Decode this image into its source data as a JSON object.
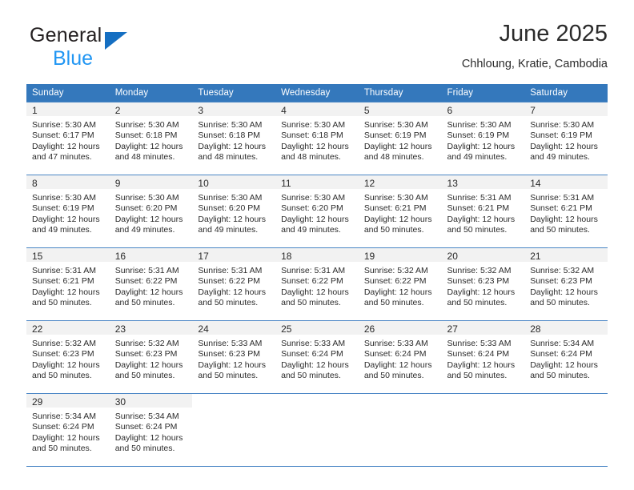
{
  "brand": {
    "name_top": "General",
    "name_bottom": "Blue",
    "triangle_color": "#156fc2",
    "blue_text_color": "#2196f3"
  },
  "header": {
    "title": "June 2025",
    "location": "Chhloung, Kratie, Cambodia"
  },
  "theme": {
    "header_background": "#3478bc",
    "header_text": "#ffffff",
    "grid_line": "#4a86c5",
    "daynum_strip": "#f2f2f2",
    "body_text": "#2b2b2b"
  },
  "weekday_headers": [
    "Sunday",
    "Monday",
    "Tuesday",
    "Wednesday",
    "Thursday",
    "Friday",
    "Saturday"
  ],
  "labels": {
    "sunrise_prefix": "Sunrise:",
    "sunset_prefix": "Sunset:",
    "daylight_prefix": "Daylight:"
  },
  "weeks": [
    [
      {
        "day": "1",
        "sunrise": "Sunrise: 5:30 AM",
        "sunset": "Sunset: 6:17 PM",
        "daylight_line1": "Daylight: 12 hours",
        "daylight_line2": "and 47 minutes."
      },
      {
        "day": "2",
        "sunrise": "Sunrise: 5:30 AM",
        "sunset": "Sunset: 6:18 PM",
        "daylight_line1": "Daylight: 12 hours",
        "daylight_line2": "and 48 minutes."
      },
      {
        "day": "3",
        "sunrise": "Sunrise: 5:30 AM",
        "sunset": "Sunset: 6:18 PM",
        "daylight_line1": "Daylight: 12 hours",
        "daylight_line2": "and 48 minutes."
      },
      {
        "day": "4",
        "sunrise": "Sunrise: 5:30 AM",
        "sunset": "Sunset: 6:18 PM",
        "daylight_line1": "Daylight: 12 hours",
        "daylight_line2": "and 48 minutes."
      },
      {
        "day": "5",
        "sunrise": "Sunrise: 5:30 AM",
        "sunset": "Sunset: 6:19 PM",
        "daylight_line1": "Daylight: 12 hours",
        "daylight_line2": "and 48 minutes."
      },
      {
        "day": "6",
        "sunrise": "Sunrise: 5:30 AM",
        "sunset": "Sunset: 6:19 PM",
        "daylight_line1": "Daylight: 12 hours",
        "daylight_line2": "and 49 minutes."
      },
      {
        "day": "7",
        "sunrise": "Sunrise: 5:30 AM",
        "sunset": "Sunset: 6:19 PM",
        "daylight_line1": "Daylight: 12 hours",
        "daylight_line2": "and 49 minutes."
      }
    ],
    [
      {
        "day": "8",
        "sunrise": "Sunrise: 5:30 AM",
        "sunset": "Sunset: 6:19 PM",
        "daylight_line1": "Daylight: 12 hours",
        "daylight_line2": "and 49 minutes."
      },
      {
        "day": "9",
        "sunrise": "Sunrise: 5:30 AM",
        "sunset": "Sunset: 6:20 PM",
        "daylight_line1": "Daylight: 12 hours",
        "daylight_line2": "and 49 minutes."
      },
      {
        "day": "10",
        "sunrise": "Sunrise: 5:30 AM",
        "sunset": "Sunset: 6:20 PM",
        "daylight_line1": "Daylight: 12 hours",
        "daylight_line2": "and 49 minutes."
      },
      {
        "day": "11",
        "sunrise": "Sunrise: 5:30 AM",
        "sunset": "Sunset: 6:20 PM",
        "daylight_line1": "Daylight: 12 hours",
        "daylight_line2": "and 49 minutes."
      },
      {
        "day": "12",
        "sunrise": "Sunrise: 5:30 AM",
        "sunset": "Sunset: 6:21 PM",
        "daylight_line1": "Daylight: 12 hours",
        "daylight_line2": "and 50 minutes."
      },
      {
        "day": "13",
        "sunrise": "Sunrise: 5:31 AM",
        "sunset": "Sunset: 6:21 PM",
        "daylight_line1": "Daylight: 12 hours",
        "daylight_line2": "and 50 minutes."
      },
      {
        "day": "14",
        "sunrise": "Sunrise: 5:31 AM",
        "sunset": "Sunset: 6:21 PM",
        "daylight_line1": "Daylight: 12 hours",
        "daylight_line2": "and 50 minutes."
      }
    ],
    [
      {
        "day": "15",
        "sunrise": "Sunrise: 5:31 AM",
        "sunset": "Sunset: 6:21 PM",
        "daylight_line1": "Daylight: 12 hours",
        "daylight_line2": "and 50 minutes."
      },
      {
        "day": "16",
        "sunrise": "Sunrise: 5:31 AM",
        "sunset": "Sunset: 6:22 PM",
        "daylight_line1": "Daylight: 12 hours",
        "daylight_line2": "and 50 minutes."
      },
      {
        "day": "17",
        "sunrise": "Sunrise: 5:31 AM",
        "sunset": "Sunset: 6:22 PM",
        "daylight_line1": "Daylight: 12 hours",
        "daylight_line2": "and 50 minutes."
      },
      {
        "day": "18",
        "sunrise": "Sunrise: 5:31 AM",
        "sunset": "Sunset: 6:22 PM",
        "daylight_line1": "Daylight: 12 hours",
        "daylight_line2": "and 50 minutes."
      },
      {
        "day": "19",
        "sunrise": "Sunrise: 5:32 AM",
        "sunset": "Sunset: 6:22 PM",
        "daylight_line1": "Daylight: 12 hours",
        "daylight_line2": "and 50 minutes."
      },
      {
        "day": "20",
        "sunrise": "Sunrise: 5:32 AM",
        "sunset": "Sunset: 6:23 PM",
        "daylight_line1": "Daylight: 12 hours",
        "daylight_line2": "and 50 minutes."
      },
      {
        "day": "21",
        "sunrise": "Sunrise: 5:32 AM",
        "sunset": "Sunset: 6:23 PM",
        "daylight_line1": "Daylight: 12 hours",
        "daylight_line2": "and 50 minutes."
      }
    ],
    [
      {
        "day": "22",
        "sunrise": "Sunrise: 5:32 AM",
        "sunset": "Sunset: 6:23 PM",
        "daylight_line1": "Daylight: 12 hours",
        "daylight_line2": "and 50 minutes."
      },
      {
        "day": "23",
        "sunrise": "Sunrise: 5:32 AM",
        "sunset": "Sunset: 6:23 PM",
        "daylight_line1": "Daylight: 12 hours",
        "daylight_line2": "and 50 minutes."
      },
      {
        "day": "24",
        "sunrise": "Sunrise: 5:33 AM",
        "sunset": "Sunset: 6:23 PM",
        "daylight_line1": "Daylight: 12 hours",
        "daylight_line2": "and 50 minutes."
      },
      {
        "day": "25",
        "sunrise": "Sunrise: 5:33 AM",
        "sunset": "Sunset: 6:24 PM",
        "daylight_line1": "Daylight: 12 hours",
        "daylight_line2": "and 50 minutes."
      },
      {
        "day": "26",
        "sunrise": "Sunrise: 5:33 AM",
        "sunset": "Sunset: 6:24 PM",
        "daylight_line1": "Daylight: 12 hours",
        "daylight_line2": "and 50 minutes."
      },
      {
        "day": "27",
        "sunrise": "Sunrise: 5:33 AM",
        "sunset": "Sunset: 6:24 PM",
        "daylight_line1": "Daylight: 12 hours",
        "daylight_line2": "and 50 minutes."
      },
      {
        "day": "28",
        "sunrise": "Sunrise: 5:34 AM",
        "sunset": "Sunset: 6:24 PM",
        "daylight_line1": "Daylight: 12 hours",
        "daylight_line2": "and 50 minutes."
      }
    ],
    [
      {
        "day": "29",
        "sunrise": "Sunrise: 5:34 AM",
        "sunset": "Sunset: 6:24 PM",
        "daylight_line1": "Daylight: 12 hours",
        "daylight_line2": "and 50 minutes."
      },
      {
        "day": "30",
        "sunrise": "Sunrise: 5:34 AM",
        "sunset": "Sunset: 6:24 PM",
        "daylight_line1": "Daylight: 12 hours",
        "daylight_line2": "and 50 minutes."
      },
      null,
      null,
      null,
      null,
      null
    ]
  ]
}
